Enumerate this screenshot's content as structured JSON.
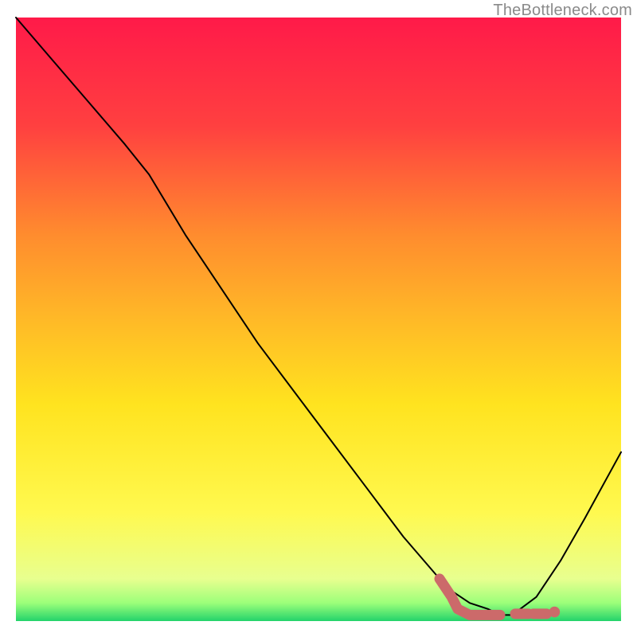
{
  "watermark": "TheBottleneck.com",
  "gradient": {
    "stops": [
      {
        "offset": 0.0,
        "color": "#ff1a49"
      },
      {
        "offset": 0.18,
        "color": "#ff4040"
      },
      {
        "offset": 0.36,
        "color": "#ff8c2e"
      },
      {
        "offset": 0.5,
        "color": "#ffb927"
      },
      {
        "offset": 0.64,
        "color": "#ffe31f"
      },
      {
        "offset": 0.82,
        "color": "#fff94f"
      },
      {
        "offset": 0.93,
        "color": "#e8ff8f"
      },
      {
        "offset": 0.97,
        "color": "#9cff7a"
      },
      {
        "offset": 1.0,
        "color": "#23d36b"
      }
    ]
  },
  "chart_data": {
    "type": "line",
    "title": "",
    "xlabel": "",
    "ylabel": "",
    "x_range": [
      0,
      100
    ],
    "y_range": [
      0,
      100
    ],
    "series": [
      {
        "name": "bottleneck-curve",
        "x": [
          0,
          6,
          12,
          18,
          22,
          28,
          34,
          40,
          46,
          52,
          58,
          64,
          70,
          72,
          75,
          78,
          80,
          82,
          86,
          90,
          94,
          100
        ],
        "y": [
          100,
          93,
          86,
          79,
          74,
          64,
          55,
          46,
          38,
          30,
          22,
          14,
          7,
          5,
          3,
          2,
          1,
          1,
          4,
          10,
          17,
          28
        ]
      }
    ],
    "optimal_region": {
      "name": "optimal-band",
      "color": "#cc6a6a",
      "points": [
        {
          "x": 70,
          "y": 7
        },
        {
          "x": 72,
          "y": 4
        },
        {
          "x": 73,
          "y": 2
        },
        {
          "x": 75,
          "y": 1
        },
        {
          "x": 78,
          "y": 1
        },
        {
          "x": 80,
          "y": 1
        }
      ],
      "dashes": [
        {
          "x": 82.5,
          "y": 1.2,
          "len": 2.2
        },
        {
          "x": 85.5,
          "y": 1.2,
          "len": 2.2
        }
      ],
      "end_dot": {
        "x": 89,
        "y": 1.5,
        "r": 1.0
      }
    }
  }
}
